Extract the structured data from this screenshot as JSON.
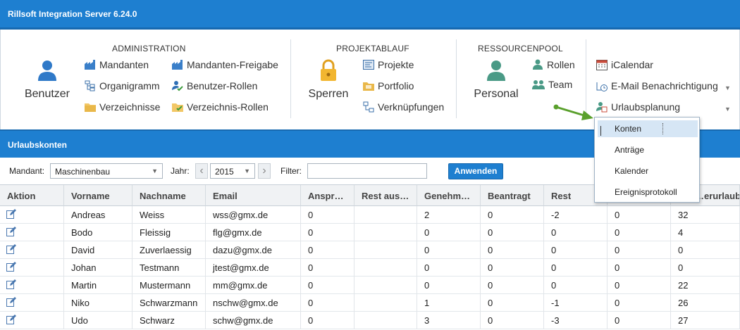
{
  "app": {
    "title": "Rillsoft Integration Server 6.24.0"
  },
  "ribbon": {
    "administration": {
      "title": "ADMINISTRATION",
      "big": {
        "label": "Benutzer",
        "icon": "user-icon"
      },
      "items": [
        {
          "label": "Mandanten",
          "icon": "factory-icon"
        },
        {
          "label": "Organigramm",
          "icon": "org-chart-icon"
        },
        {
          "label": "Verzeichnisse",
          "icon": "folder-icon"
        },
        {
          "label": "Mandanten-Freigabe",
          "icon": "factory-icon"
        },
        {
          "label": "Benutzer-Rollen",
          "icon": "user-check-icon"
        },
        {
          "label": "Verzeichnis-Rollen",
          "icon": "folder-check-icon"
        }
      ]
    },
    "projektablauf": {
      "title": "PROJEKTABLAUF",
      "big": {
        "label": "Sperren",
        "icon": "lock-icon"
      },
      "items": [
        {
          "label": "Projekte",
          "icon": "project-icon"
        },
        {
          "label": "Portfolio",
          "icon": "portfolio-icon"
        },
        {
          "label": "Verknüpfungen",
          "icon": "link-icon"
        }
      ]
    },
    "ressourcenpool": {
      "title": "RESSOURCENPOOL",
      "big": {
        "label": "Personal",
        "icon": "person-icon"
      },
      "items": [
        {
          "label": "Rollen",
          "icon": "role-icon"
        },
        {
          "label": "Team",
          "icon": "team-icon"
        }
      ]
    },
    "extras": {
      "items": [
        {
          "label": "iCalendar",
          "icon": "calendar-icon"
        },
        {
          "label": "E-Mail Benachrichtigung",
          "icon": "email-notify-icon"
        },
        {
          "label": "Urlaubsplanung",
          "icon": "vacation-icon"
        }
      ]
    }
  },
  "section": {
    "title": "Urlaubskonten"
  },
  "filters": {
    "mandant_label": "Mandant:",
    "mandant_value": "Maschinenbau",
    "jahr_label": "Jahr:",
    "jahr_value": "2015",
    "filter_label": "Filter:",
    "filter_value": "",
    "apply_label": "Anwenden"
  },
  "table": {
    "columns": [
      "Aktion",
      "Vorname",
      "Nachname",
      "Email",
      "Anspr…",
      "Rest aus…",
      "Genehm…",
      "Beantragt",
      "Rest",
      "",
      "…erurlaub"
    ],
    "rows": [
      [
        "",
        "Andreas",
        "Weiss",
        "wss@gmx.de",
        "0",
        "",
        "2",
        "0",
        "-2",
        "0",
        "32"
      ],
      [
        "",
        "Bodo",
        "Fleissig",
        "flg@gmx.de",
        "0",
        "",
        "0",
        "0",
        "0",
        "0",
        "4"
      ],
      [
        "",
        "David",
        "Zuverlaessig",
        "dazu@gmx.de",
        "0",
        "",
        "0",
        "0",
        "0",
        "0",
        "0"
      ],
      [
        "",
        "Johan",
        "Testmann",
        "jtest@gmx.de",
        "0",
        "",
        "0",
        "0",
        "0",
        "0",
        "0"
      ],
      [
        "",
        "Martin",
        "Mustermann",
        "mm@gmx.de",
        "0",
        "",
        "0",
        "0",
        "0",
        "0",
        "22"
      ],
      [
        "",
        "Niko",
        "Schwarzmann",
        "nschw@gmx.de",
        "0",
        "",
        "1",
        "0",
        "-1",
        "0",
        "26"
      ],
      [
        "",
        "Udo",
        "Schwarz",
        "schw@gmx.de",
        "0",
        "",
        "3",
        "0",
        "-3",
        "0",
        "27"
      ]
    ]
  },
  "dropdown": {
    "items": [
      "Konten",
      "Anträge",
      "Kalender",
      "Ereignisprotokoll"
    ],
    "selected": "Konten"
  },
  "colors": {
    "accent": "#1e7fd0",
    "arrow": "#5aa02c",
    "selection": "#d6e6f5"
  }
}
